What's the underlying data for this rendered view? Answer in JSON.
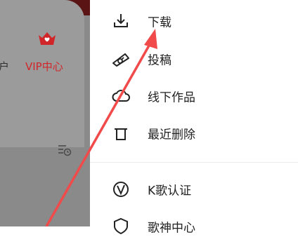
{
  "left_panel": {
    "cut_label": "户",
    "vip_label": "VIP中心",
    "vip_icon": "crown-heart-icon",
    "settings_icon": "list-clock-icon"
  },
  "menu": {
    "items": [
      {
        "label": "下载",
        "icon": "download-icon"
      },
      {
        "label": "投稿",
        "icon": "submit-ticket-icon"
      },
      {
        "label": "线下作品",
        "icon": "cloud-icon"
      },
      {
        "label": "最近删除",
        "icon": "trash-icon"
      },
      {
        "label": "K歌认证",
        "icon": "verify-v-icon"
      },
      {
        "label": "歌神中心",
        "icon": "shield-icon"
      }
    ]
  },
  "colors": {
    "accent_red": "#d0262a",
    "arrow_red": "#f04a4a"
  }
}
